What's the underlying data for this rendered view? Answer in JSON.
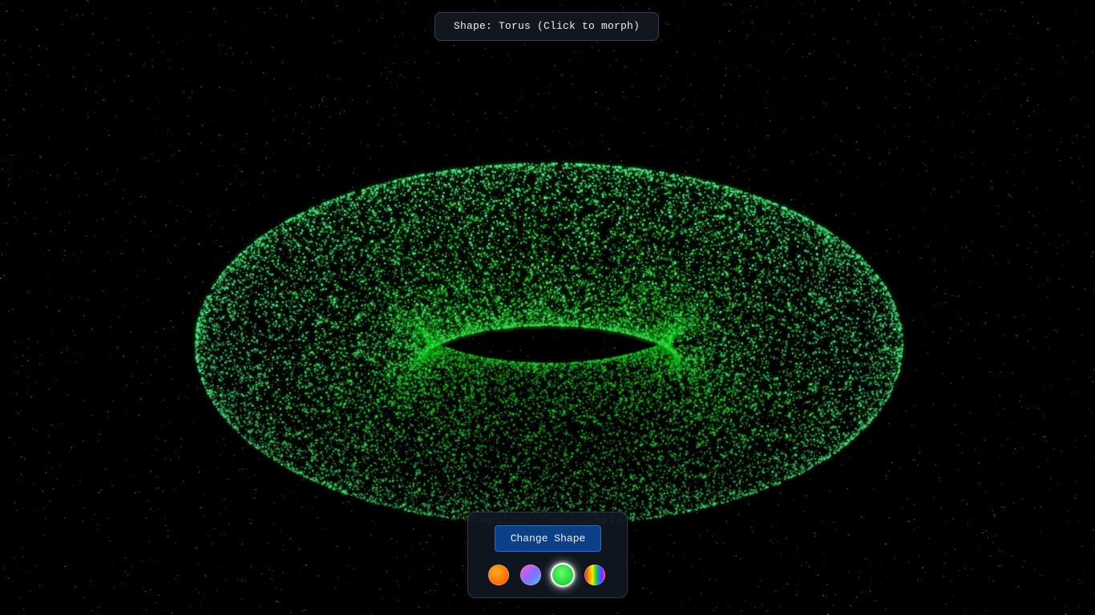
{
  "header": {
    "shape_label": "Shape: Torus (Click to morph)"
  },
  "controls": {
    "change_shape_label": "Change Shape",
    "palettes": [
      {
        "name": "fire",
        "icon": "orange-swatch-icon",
        "selected": false
      },
      {
        "name": "nebula",
        "icon": "pink-purple-swatch-icon",
        "selected": false
      },
      {
        "name": "matrix",
        "icon": "green-swatch-icon",
        "selected": true
      },
      {
        "name": "rainbow",
        "icon": "rainbow-swatch-icon",
        "selected": false
      }
    ]
  },
  "scene": {
    "shape": "torus",
    "background": "#000000",
    "colors": {
      "particle_outer": "#7cf5b8",
      "particle_inner": "#5cff3c",
      "particle_glow": "#2ecc5a",
      "star": "#ffffff"
    }
  }
}
